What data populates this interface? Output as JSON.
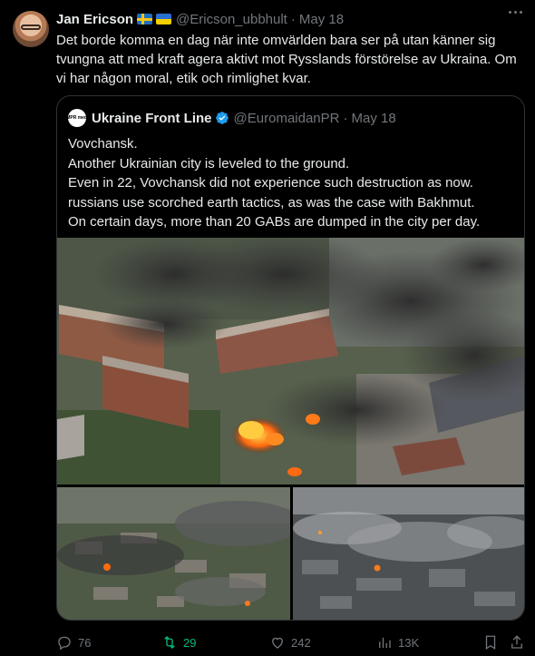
{
  "author": {
    "name": "Jan Ericson",
    "handle": "@Ericson_ubbhult",
    "date": "May 18",
    "separator": "·"
  },
  "tweet_text": "Det borde komma en dag när inte omvärlden bara ser på utan känner sig tvungna att med kraft agera aktivt mot Rysslands förstörelse av Ukraina. Om vi har någon moral, etik och rimlighet kvar.",
  "quoted": {
    "avatar_text": "EMPR media",
    "name": "Ukraine Front Line",
    "handle": "@EuromaidanPR",
    "separator": "·",
    "date": "May 18",
    "lines": [
      "Vovchansk.",
      "Another Ukrainian city is leveled to the ground.",
      "Even in 22, Vovchansk did not experience such destruction as now.",
      "russians use scorched earth tactics, as was the case with Bakhmut.",
      "On certain days, more than 20 GABs are dumped in the city per day."
    ]
  },
  "actions": {
    "replies": "76",
    "retweets": "29",
    "likes": "242",
    "views": "13K"
  },
  "colors": {
    "background": "#000000",
    "text": "#e7e9ea",
    "muted": "#71767b",
    "retweet": "#00ba7c",
    "verified": "#1d9bf0"
  }
}
